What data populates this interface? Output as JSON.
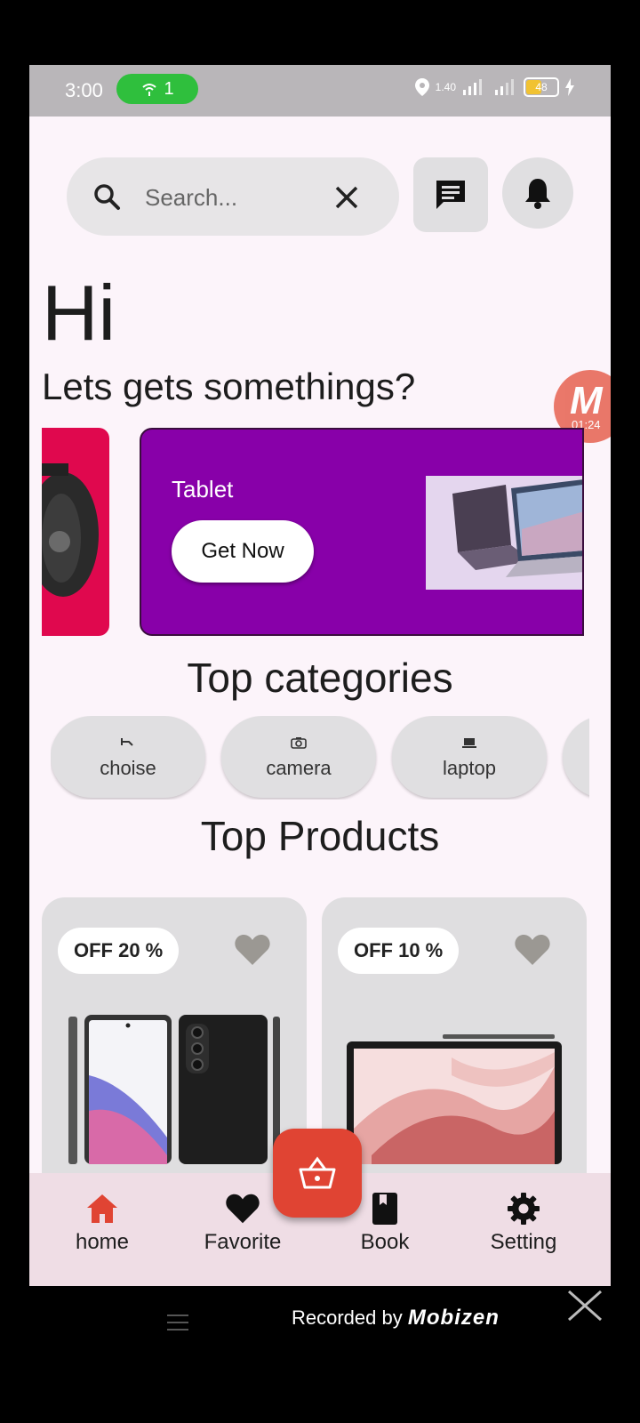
{
  "status_bar": {
    "time": "3:00",
    "hotspot_count": "1",
    "network_speed": "1.40",
    "battery": "48",
    "colors": {
      "hotspot": "#2fbf3d",
      "battery": "#f1c232"
    }
  },
  "search": {
    "placeholder": "Search...",
    "value": ""
  },
  "greeting": {
    "title": "Hi",
    "subtitle": "Lets gets somethings?"
  },
  "recorder_badge": {
    "letter": "M",
    "timer": "01:24"
  },
  "banner": {
    "label": "Tablet",
    "button": "Get Now",
    "colors": {
      "main": "#8800a9",
      "side": "#e0084e"
    }
  },
  "categories": {
    "title": "Top categories",
    "items": [
      {
        "label": "choise",
        "icon": "choice-icon"
      },
      {
        "label": "camera",
        "icon": "camera-icon"
      },
      {
        "label": "laptop",
        "icon": "laptop-icon"
      }
    ]
  },
  "products": {
    "title": "Top Products",
    "items": [
      {
        "discount": "OFF 20 %",
        "image": "phone-image"
      },
      {
        "discount": "OFF 10 %",
        "image": "tablet-image"
      }
    ]
  },
  "bottom_nav": {
    "items": [
      {
        "label": "home",
        "icon": "home-icon",
        "active": true
      },
      {
        "label": "Favorite",
        "icon": "heart-icon",
        "active": false
      },
      {
        "label": "Book",
        "icon": "book-icon",
        "active": false
      },
      {
        "label": "Setting",
        "icon": "gear-icon",
        "active": false
      }
    ],
    "fab_icon": "basket-icon",
    "colors": {
      "accent": "#e04433",
      "background": "#efdde5"
    }
  },
  "watermark": {
    "prefix": "Recorded by",
    "brand": "Mobizen"
  }
}
